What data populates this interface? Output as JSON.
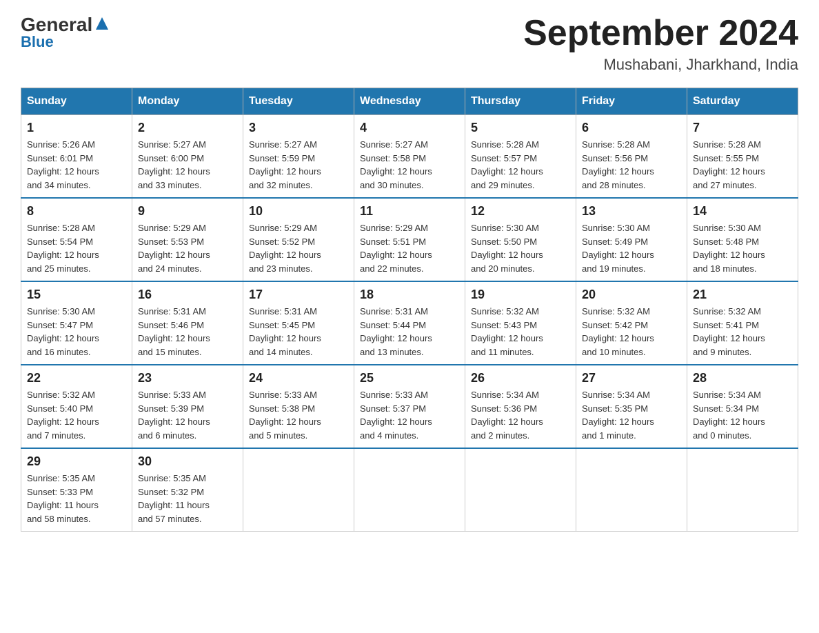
{
  "logo": {
    "general": "General",
    "arrow": "▲",
    "blue": "Blue"
  },
  "title": "September 2024",
  "location": "Mushabani, Jharkhand, India",
  "weekdays": [
    "Sunday",
    "Monday",
    "Tuesday",
    "Wednesday",
    "Thursday",
    "Friday",
    "Saturday"
  ],
  "weeks": [
    [
      {
        "day": "1",
        "sunrise": "5:26 AM",
        "sunset": "6:01 PM",
        "daylight": "12 hours and 34 minutes."
      },
      {
        "day": "2",
        "sunrise": "5:27 AM",
        "sunset": "6:00 PM",
        "daylight": "12 hours and 33 minutes."
      },
      {
        "day": "3",
        "sunrise": "5:27 AM",
        "sunset": "5:59 PM",
        "daylight": "12 hours and 32 minutes."
      },
      {
        "day": "4",
        "sunrise": "5:27 AM",
        "sunset": "5:58 PM",
        "daylight": "12 hours and 30 minutes."
      },
      {
        "day": "5",
        "sunrise": "5:28 AM",
        "sunset": "5:57 PM",
        "daylight": "12 hours and 29 minutes."
      },
      {
        "day": "6",
        "sunrise": "5:28 AM",
        "sunset": "5:56 PM",
        "daylight": "12 hours and 28 minutes."
      },
      {
        "day": "7",
        "sunrise": "5:28 AM",
        "sunset": "5:55 PM",
        "daylight": "12 hours and 27 minutes."
      }
    ],
    [
      {
        "day": "8",
        "sunrise": "5:28 AM",
        "sunset": "5:54 PM",
        "daylight": "12 hours and 25 minutes."
      },
      {
        "day": "9",
        "sunrise": "5:29 AM",
        "sunset": "5:53 PM",
        "daylight": "12 hours and 24 minutes."
      },
      {
        "day": "10",
        "sunrise": "5:29 AM",
        "sunset": "5:52 PM",
        "daylight": "12 hours and 23 minutes."
      },
      {
        "day": "11",
        "sunrise": "5:29 AM",
        "sunset": "5:51 PM",
        "daylight": "12 hours and 22 minutes."
      },
      {
        "day": "12",
        "sunrise": "5:30 AM",
        "sunset": "5:50 PM",
        "daylight": "12 hours and 20 minutes."
      },
      {
        "day": "13",
        "sunrise": "5:30 AM",
        "sunset": "5:49 PM",
        "daylight": "12 hours and 19 minutes."
      },
      {
        "day": "14",
        "sunrise": "5:30 AM",
        "sunset": "5:48 PM",
        "daylight": "12 hours and 18 minutes."
      }
    ],
    [
      {
        "day": "15",
        "sunrise": "5:30 AM",
        "sunset": "5:47 PM",
        "daylight": "12 hours and 16 minutes."
      },
      {
        "day": "16",
        "sunrise": "5:31 AM",
        "sunset": "5:46 PM",
        "daylight": "12 hours and 15 minutes."
      },
      {
        "day": "17",
        "sunrise": "5:31 AM",
        "sunset": "5:45 PM",
        "daylight": "12 hours and 14 minutes."
      },
      {
        "day": "18",
        "sunrise": "5:31 AM",
        "sunset": "5:44 PM",
        "daylight": "12 hours and 13 minutes."
      },
      {
        "day": "19",
        "sunrise": "5:32 AM",
        "sunset": "5:43 PM",
        "daylight": "12 hours and 11 minutes."
      },
      {
        "day": "20",
        "sunrise": "5:32 AM",
        "sunset": "5:42 PM",
        "daylight": "12 hours and 10 minutes."
      },
      {
        "day": "21",
        "sunrise": "5:32 AM",
        "sunset": "5:41 PM",
        "daylight": "12 hours and 9 minutes."
      }
    ],
    [
      {
        "day": "22",
        "sunrise": "5:32 AM",
        "sunset": "5:40 PM",
        "daylight": "12 hours and 7 minutes."
      },
      {
        "day": "23",
        "sunrise": "5:33 AM",
        "sunset": "5:39 PM",
        "daylight": "12 hours and 6 minutes."
      },
      {
        "day": "24",
        "sunrise": "5:33 AM",
        "sunset": "5:38 PM",
        "daylight": "12 hours and 5 minutes."
      },
      {
        "day": "25",
        "sunrise": "5:33 AM",
        "sunset": "5:37 PM",
        "daylight": "12 hours and 4 minutes."
      },
      {
        "day": "26",
        "sunrise": "5:34 AM",
        "sunset": "5:36 PM",
        "daylight": "12 hours and 2 minutes."
      },
      {
        "day": "27",
        "sunrise": "5:34 AM",
        "sunset": "5:35 PM",
        "daylight": "12 hours and 1 minute."
      },
      {
        "day": "28",
        "sunrise": "5:34 AM",
        "sunset": "5:34 PM",
        "daylight": "12 hours and 0 minutes."
      }
    ],
    [
      {
        "day": "29",
        "sunrise": "5:35 AM",
        "sunset": "5:33 PM",
        "daylight": "11 hours and 58 minutes."
      },
      {
        "day": "30",
        "sunrise": "5:35 AM",
        "sunset": "5:32 PM",
        "daylight": "11 hours and 57 minutes."
      },
      null,
      null,
      null,
      null,
      null
    ]
  ],
  "labels": {
    "sunrise": "Sunrise:",
    "sunset": "Sunset:",
    "daylight": "Daylight:"
  }
}
